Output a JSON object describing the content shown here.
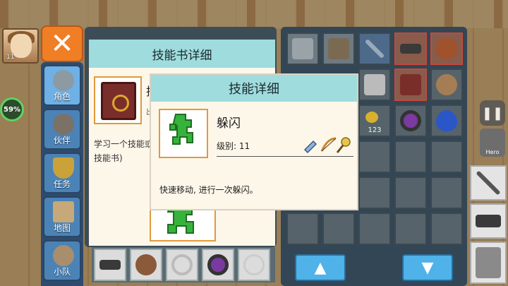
{
  "hud": {
    "hero_level": "11",
    "progress_label": "59%",
    "progress": 0.59,
    "hero_button_label": "Hero"
  },
  "side_menu": {
    "items": [
      {
        "label": "角色",
        "icon": "helmet-icon"
      },
      {
        "label": "伙伴",
        "icon": "horned-helmet-icon"
      },
      {
        "label": "任务",
        "icon": "trophy-icon"
      },
      {
        "label": "地图",
        "icon": "map-icon"
      },
      {
        "label": "小队",
        "icon": "party-icon"
      }
    ],
    "active_index": 0
  },
  "book_panel": {
    "title": "技能书详细",
    "name_clip": "技",
    "sub_clip": "出",
    "description": "学习一个技能或\n技能书)"
  },
  "dialog": {
    "title": "技能详细",
    "skill_name": "躲闪",
    "level_label": "级别: 11",
    "description": "快速移动, 进行一次躲闪。"
  },
  "inventory": {
    "stack_count": "123",
    "up_label": "▲",
    "down_label": "▼"
  },
  "colors": {
    "accent_orange": "#f07e25",
    "header_teal": "#9fdcdd",
    "menu_blue": "#4b83b7",
    "panel_dark": "#324656",
    "paper": "#fdf7ea"
  }
}
